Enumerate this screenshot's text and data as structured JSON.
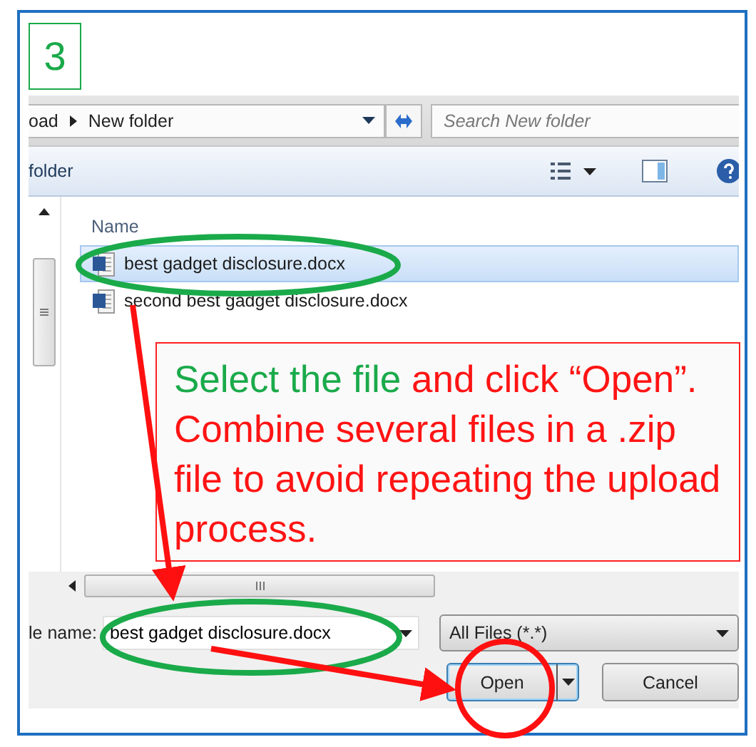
{
  "step": "3",
  "address": {
    "crumbs": [
      "oad",
      "New folder"
    ],
    "placeholder": "Search New folder"
  },
  "toolbar": {
    "label": "folder"
  },
  "file_list": {
    "column": "Name",
    "files": [
      {
        "name": "best gadget disclosure.docx",
        "selected": true
      },
      {
        "name": "second best gadget disclosure.docx",
        "selected": false
      }
    ]
  },
  "file_name": {
    "label": "le name:",
    "value": "best gadget disclosure.docx"
  },
  "file_type": {
    "value": "All Files (*.*)"
  },
  "buttons": [
    {
      "label": "Open",
      "kind": "split"
    },
    {
      "label": "Cancel",
      "kind": "plain"
    }
  ],
  "callout": {
    "lead": "Select the file",
    "text": "and click “Open”. Combine several files in a .zip file to avoid repeating the upload process."
  }
}
